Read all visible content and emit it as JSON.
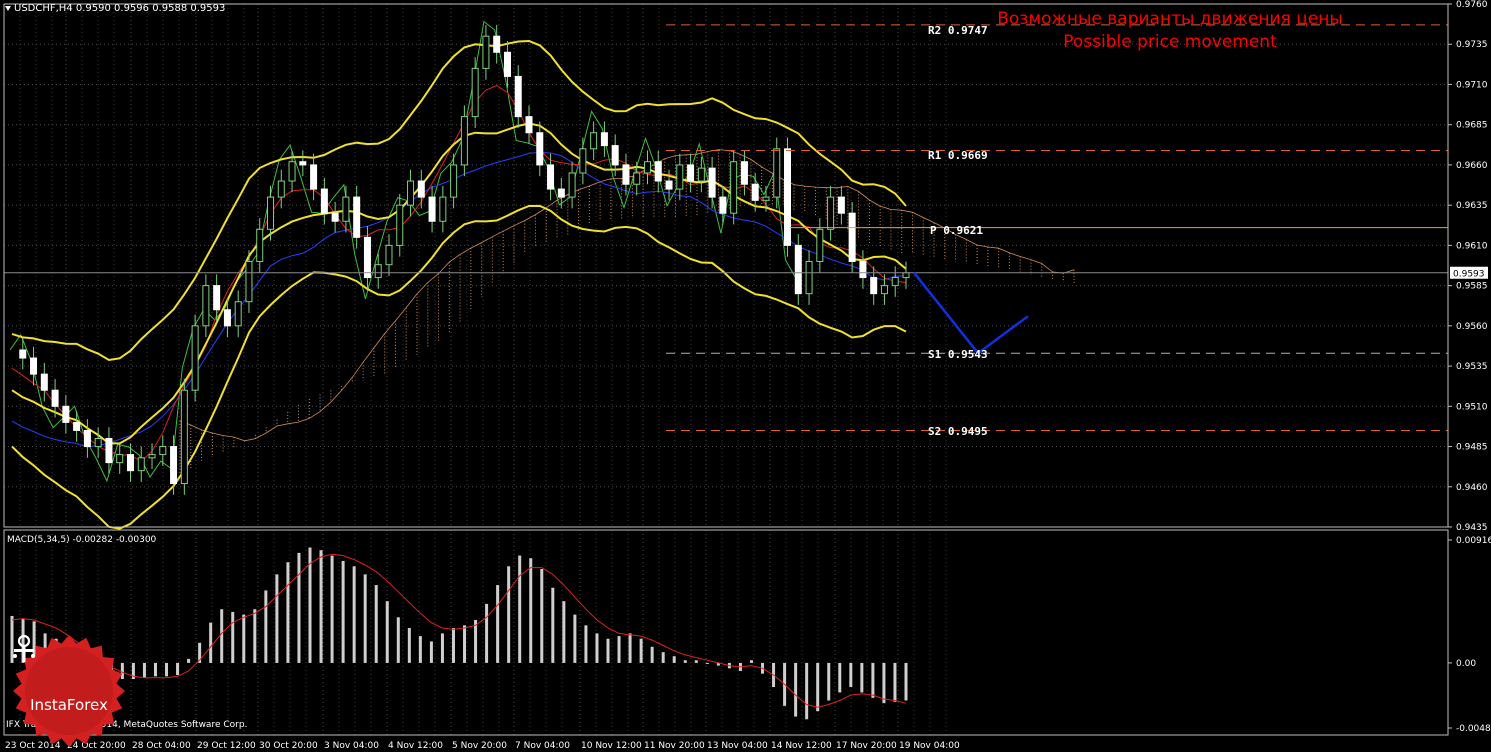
{
  "header": {
    "symbol_line": "USDCHF,H4  0.9590 0.9596 0.9588 0.9593"
  },
  "annotation": {
    "line_ru": "Возможные варианты движения цены",
    "line_en": "Possible price movement",
    "color": "#ff0000"
  },
  "levels": [
    {
      "label": "R2  0.9747",
      "value": 0.9747,
      "color": "#e06030"
    },
    {
      "label": "R1  0.9669",
      "value": 0.9669,
      "color": "#e06030"
    },
    {
      "label": "P  0.9621",
      "value": 0.9621,
      "color": "#f0a030"
    },
    {
      "label": "S1  0.9543",
      "value": 0.9543,
      "color": "#b0b0b0"
    },
    {
      "label": "S2  0.9495",
      "value": 0.9495,
      "color": "#e06030"
    }
  ],
  "macd": {
    "label": "MACD(5,34,5) -0.00282 -0.00300",
    "y_ticks": [
      "0.00916",
      "0.00",
      "-0.00485"
    ]
  },
  "footer": {
    "copyright": "IFX Trader, © 2001-2014, MetaQuotes Software Corp."
  },
  "logo": {
    "text": "InstaForex"
  },
  "chart_data": {
    "type": "candlestick",
    "symbol": "USDCHF",
    "timeframe": "H4",
    "ylim": [
      0.9435,
      0.976
    ],
    "y_ticks": [
      "0.9760",
      "0.9735",
      "0.9710",
      "0.9685",
      "0.9660",
      "0.9635",
      "0.9610",
      "0.9585",
      "0.9560",
      "0.9535",
      "0.9510",
      "0.9485",
      "0.9460",
      "0.9435"
    ],
    "current_price": "0.9593",
    "x_ticks": [
      "23 Oct 2014",
      "24 Oct 20:00",
      "28 Oct 04:00",
      "29 Oct 12:00",
      "30 Oct 20:00",
      "3 Nov 04:00",
      "4 Nov 12:00",
      "5 Nov 20:00",
      "7 Nov 04:00",
      "10 Nov 12:00",
      "11 Nov 20:00",
      "13 Nov 04:00",
      "14 Nov 12:00",
      "17 Nov 20:00",
      "19 Nov 04:00"
    ],
    "close_series": [
      0.9545,
      0.954,
      0.953,
      0.952,
      0.951,
      0.95,
      0.9495,
      0.9485,
      0.949,
      0.9475,
      0.948,
      0.947,
      0.9478,
      0.948,
      0.9485,
      0.9462,
      0.952,
      0.956,
      0.9585,
      0.957,
      0.956,
      0.9575,
      0.96,
      0.962,
      0.964,
      0.965,
      0.9662,
      0.966,
      0.9645,
      0.963,
      0.9625,
      0.964,
      0.9615,
      0.959,
      0.9598,
      0.961,
      0.9635,
      0.965,
      0.964,
      0.9625,
      0.964,
      0.966,
      0.969,
      0.972,
      0.974,
      0.973,
      0.9715,
      0.969,
      0.968,
      0.966,
      0.9645,
      0.964,
      0.9655,
      0.967,
      0.968,
      0.9672,
      0.966,
      0.9648,
      0.9655,
      0.9662,
      0.965,
      0.9645,
      0.966,
      0.965,
      0.9658,
      0.964,
      0.963,
      0.9662,
      0.9648,
      0.9638,
      0.964,
      0.967,
      0.961,
      0.958,
      0.96,
      0.962,
      0.964,
      0.963,
      0.96,
      0.959,
      0.958,
      0.9585,
      0.959,
      0.9593
    ],
    "forecast": [
      0.9593,
      0.9543,
      0.9566
    ],
    "macd_ylim": [
      -0.00485,
      0.00916
    ],
    "macd_hist": [
      0.0035,
      0.0033,
      0.0031,
      0.0022,
      0.0018,
      0.0012,
      0.0006,
      0.0002,
      -0.0004,
      -0.001,
      -0.0012,
      -0.0012,
      -0.0011,
      -0.001,
      -0.001,
      -0.0009,
      0.0003,
      0.0015,
      0.003,
      0.004,
      0.0038,
      0.0036,
      0.004,
      0.0054,
      0.0066,
      0.0075,
      0.0082,
      0.0086,
      0.0084,
      0.008,
      0.0076,
      0.0072,
      0.0066,
      0.0058,
      0.0046,
      0.0034,
      0.0026,
      0.002,
      0.0016,
      0.0022,
      0.0026,
      0.0028,
      0.0032,
      0.0044,
      0.0058,
      0.0072,
      0.008,
      0.0078,
      0.007,
      0.0056,
      0.0046,
      0.0036,
      0.0028,
      0.0022,
      0.0018,
      0.002,
      0.0022,
      0.0018,
      0.0012,
      0.0008,
      0.0005,
      0.0002,
      0.0002,
      0.0,
      -0.0002,
      -0.0004,
      -0.0006,
      0.0002,
      -0.0008,
      -0.0018,
      -0.0032,
      -0.004,
      -0.0042,
      -0.0036,
      -0.0028,
      -0.0022,
      -0.0018,
      -0.0022,
      -0.0026,
      -0.003,
      -0.0029,
      -0.0028
    ],
    "macd_signal": [
      0.0032,
      0.0033,
      0.0032,
      0.0029,
      0.0026,
      0.0021,
      0.0015,
      0.0009,
      0.0003,
      -0.0003,
      -0.0007,
      -0.001,
      -0.0011,
      -0.0011,
      -0.0011,
      -0.001,
      -0.0006,
      0.0002,
      0.0012,
      0.0022,
      0.003,
      0.0034,
      0.0037,
      0.0042,
      0.005,
      0.0058,
      0.0066,
      0.0074,
      0.0079,
      0.0081,
      0.008,
      0.0077,
      0.0073,
      0.0068,
      0.0061,
      0.0053,
      0.0045,
      0.0037,
      0.003,
      0.0026,
      0.0025,
      0.0026,
      0.0028,
      0.0034,
      0.0043,
      0.0054,
      0.0065,
      0.0071,
      0.0071,
      0.0066,
      0.0058,
      0.0049,
      0.004,
      0.0032,
      0.0026,
      0.0022,
      0.0021,
      0.002,
      0.0017,
      0.0013,
      0.0009,
      0.0006,
      0.0004,
      0.0002,
      0.0,
      -0.0002,
      -0.0003,
      -0.0002,
      -0.0004,
      -0.0009,
      -0.0016,
      -0.0024,
      -0.0031,
      -0.0033,
      -0.0031,
      -0.0028,
      -0.0024,
      -0.0023,
      -0.0024,
      -0.0027,
      -0.0028,
      -0.003
    ]
  }
}
